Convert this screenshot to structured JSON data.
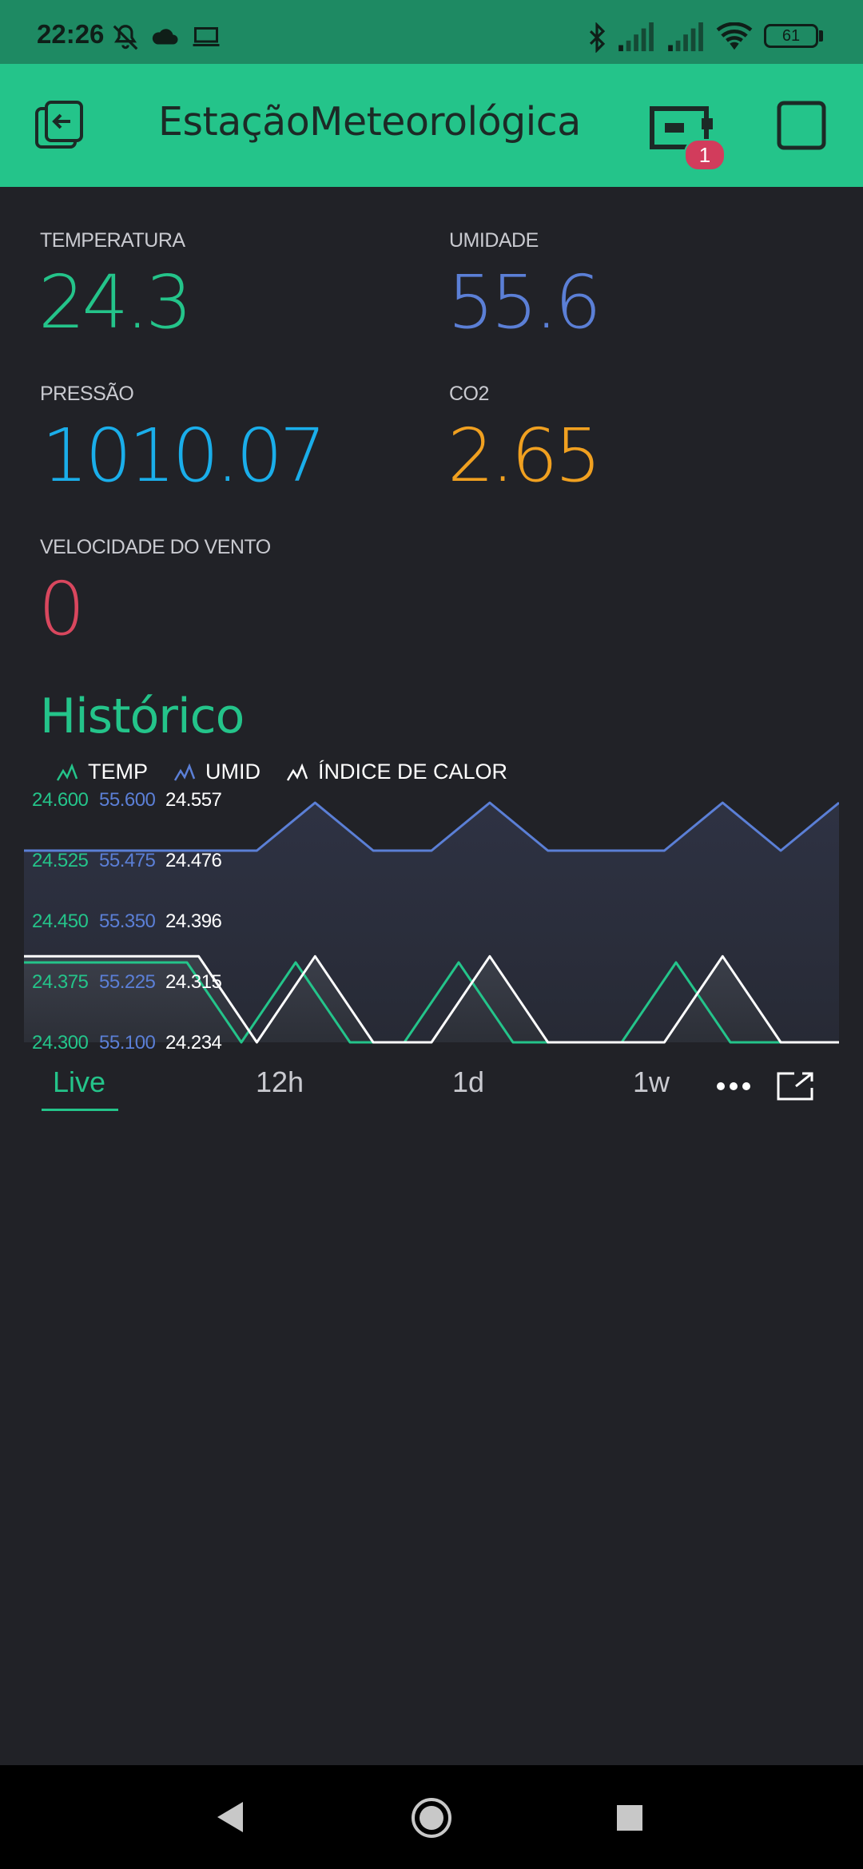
{
  "status_bar": {
    "time": "22:26",
    "battery": "61",
    "icons": [
      "mute-bell-icon",
      "cloud-icon",
      "laptop-icon",
      "bluetooth-icon",
      "signal-icon",
      "signal-icon",
      "wifi-icon",
      "battery-icon"
    ]
  },
  "app_bar": {
    "title": "EstaçãoMeteorológica",
    "device_badge": "1",
    "icons": [
      "exit-icon",
      "device-icon",
      "square-icon"
    ],
    "color": "#24c48a"
  },
  "metrics": [
    {
      "label": "TEMPERATURA",
      "value": "24.3",
      "color": "#24c48a"
    },
    {
      "label": "UMIDADE",
      "value": "55.6",
      "color": "#5b7fd6"
    },
    {
      "label": "PRESSÃO",
      "value": "1010.07",
      "color": "#1aaeea"
    },
    {
      "label": "CO2",
      "value": "2.65",
      "color": "#f0a020"
    },
    {
      "label": "VELOCIDADE DO VENTO",
      "value": "0",
      "color": "#d9475e"
    }
  ],
  "history": {
    "title": "Histórico",
    "tabs": [
      "Live",
      "12h",
      "1d",
      "1w"
    ],
    "active_tab": "Live",
    "more_icon": "more-dots-icon",
    "fullscreen_icon": "expand-icon"
  },
  "chart_data": {
    "type": "line",
    "legend": [
      "TEMP",
      "UMID",
      "ÍNDICE DE CALOR"
    ],
    "legend_placement": "top-left",
    "series": [
      {
        "name": "TEMP",
        "color": "#24c48a",
        "y_ticks": [
          "24.600",
          "24.525",
          "24.450",
          "24.375",
          "24.300"
        ],
        "ylim": [
          24.3,
          24.6
        ],
        "values": [
          24.4,
          24.4,
          24.4,
          24.4,
          24.3,
          24.4,
          24.3,
          24.3,
          24.4,
          24.3,
          24.3,
          24.3,
          24.4,
          24.3,
          24.3,
          24.3
        ]
      },
      {
        "name": "UMID",
        "color": "#5b7fd6",
        "y_ticks": [
          "55.600",
          "55.475",
          "55.350",
          "55.225",
          "55.100"
        ],
        "ylim": [
          55.1,
          55.6
        ],
        "values": [
          55.5,
          55.5,
          55.5,
          55.5,
          55.5,
          55.6,
          55.5,
          55.5,
          55.6,
          55.5,
          55.5,
          55.5,
          55.6,
          55.5,
          55.6
        ]
      },
      {
        "name": "ÍNDICE DE CALOR",
        "color": "#ffffff",
        "y_ticks": [
          "24.557",
          "24.476",
          "24.396",
          "24.315",
          "24.234"
        ],
        "ylim": [
          24.234,
          24.557
        ],
        "values": [
          24.35,
          24.35,
          24.35,
          24.35,
          24.234,
          24.35,
          24.234,
          24.234,
          24.35,
          24.234,
          24.234,
          24.234,
          24.35,
          24.234,
          24.234
        ]
      }
    ]
  }
}
